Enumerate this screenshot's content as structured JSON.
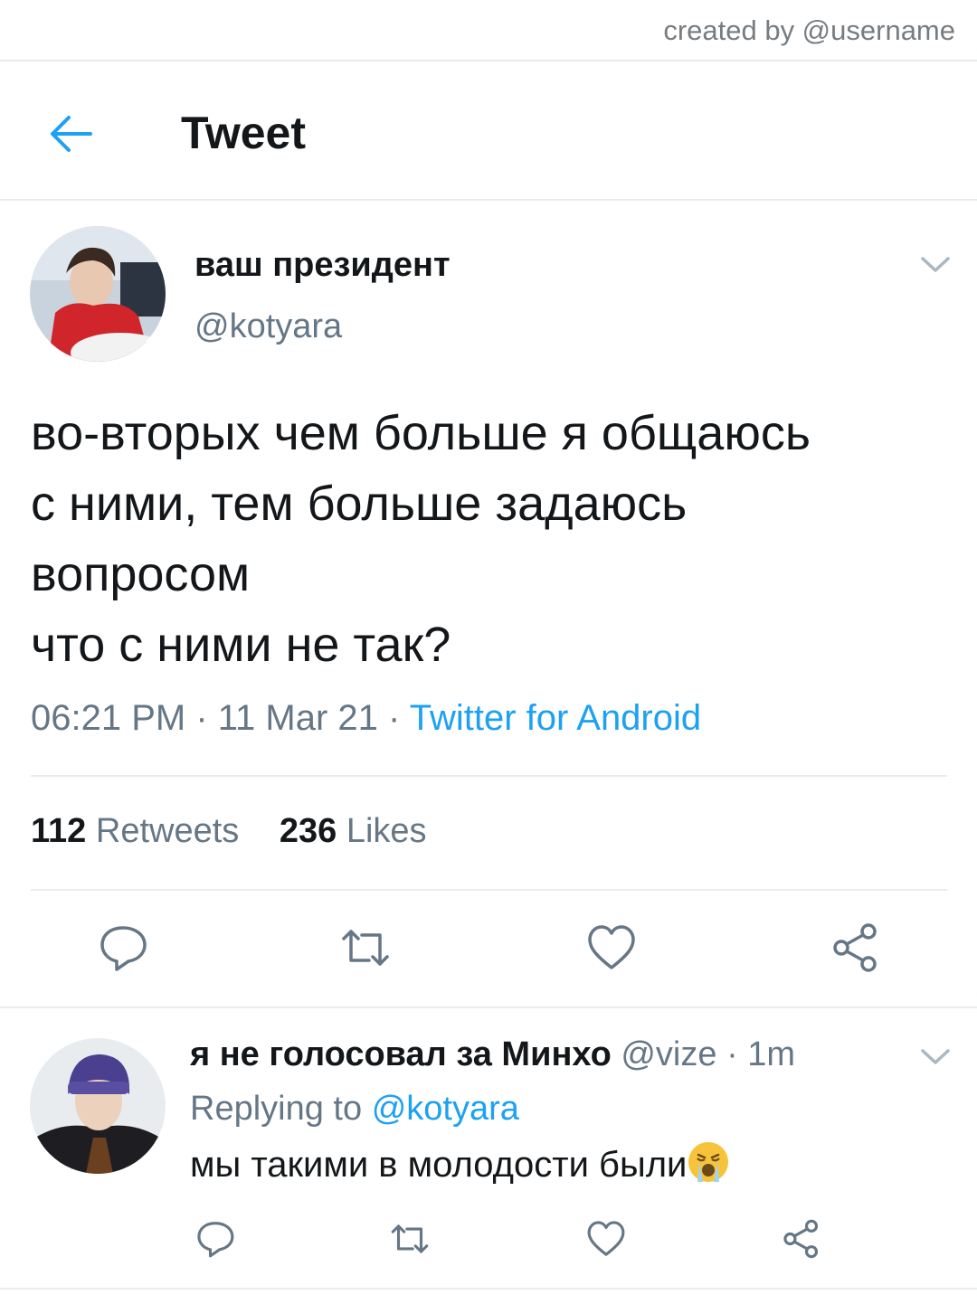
{
  "watermark": "created by @username",
  "header": {
    "title": "Tweet",
    "back_icon": "arrow-left-icon"
  },
  "tweet": {
    "author_name": "ваш президент",
    "author_handle": "@kotyara",
    "text_lines": [
      "во-вторых чем больше я общаюсь",
      "с ними, тем больше задаюсь",
      "вопросом",
      "что с ними не так?"
    ],
    "time": "06:21 PM",
    "date": "11 Mar 21",
    "source": "Twitter for Android",
    "retweets_count": "112",
    "retweets_label": "Retweets",
    "likes_count": "236",
    "likes_label": "Likes"
  },
  "reply": {
    "author_name": "я не голосовал за Минхо",
    "author_handle": "@vize",
    "time": "1m",
    "replying_prefix": "Replying to",
    "replying_to": "@kotyara",
    "text": "мы такими в молодости были",
    "emoji": "crying-face-emoji"
  },
  "colors": {
    "accent": "#1da1f2",
    "text": "#14171a",
    "muted": "#657786",
    "divider": "#e6ecf0"
  }
}
